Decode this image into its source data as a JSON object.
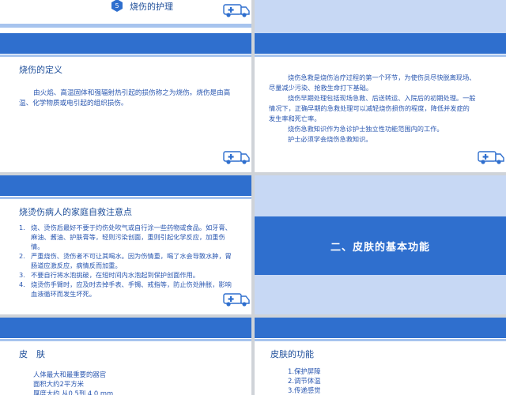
{
  "slide1": {
    "badge": "5",
    "title": "烧伤的护理"
  },
  "slide3": {
    "title": "烧伤的定义",
    "body": "由火焰、高温固体和强辐射热引起的损伤称之为烧伤。烧伤是由高温、化学物质或电引起的组织损伤。"
  },
  "slide4": {
    "lines": [
      "烧伤急救是烧伤治疗过程的第一个环节，为使伤员尽快脱离现场、",
      "尽量减少污染、抢救生命打下基础。",
      "烧伤早期处理包括现场急救、后送转运、入院后的初期处理。一般",
      "情况下，正确早期的急救处理可以减轻烧伤损伤的程度，降低并发症的",
      "发生率和死亡率。",
      "烧伤急救知识作为急诊护士独立性功能范围内的工作。",
      "护士必须学会烧伤急救知识。"
    ]
  },
  "slide5": {
    "title": "烧烫伤病人的家庭自救注意点",
    "items": [
      {
        "n": "1.",
        "text": "烧、烫伤后最好不要于灼伤处吹气或自行涂一些药物或食品。如牙膏、麻油、酱油、护肤膏等，轻则污染创面，重则引起化学反应，加重伤情。"
      },
      {
        "n": "2.",
        "text": "严重烧伤、烫伤者不可让其喝水。因为伤情重，喝了水会导致水肿，胃肠道应激反应，病情反而加重。"
      },
      {
        "n": "3.",
        "text": "不要自行将水泡挑破，在短时间内水泡起到保护创面作用。"
      },
      {
        "n": "4.",
        "text": "烧烫伤手臂时，应及时去掉手表、手镯、戒指等，防止伤处肿胀，影响血液循环而发生坏死。"
      }
    ]
  },
  "slide6": {
    "heading": "二、皮肤的基本功能"
  },
  "slide7": {
    "title": "皮　肤",
    "lines": [
      "人体最大和最重要的器官",
      "面积大约2平方米",
      "厚度大约 从0.5到 4.0 mm"
    ]
  },
  "slide8": {
    "title": "皮肤的功能",
    "items": [
      "1.保护屏障",
      "2.调节体温",
      "3.传递感觉"
    ]
  },
  "colors": {
    "accent": "#2f6fce",
    "text": "#2a57b0",
    "band_light": "#a7c4ee",
    "slide_blue": "#c7d8f4"
  },
  "icons": [
    "ambulance-icon",
    "step-badge"
  ]
}
